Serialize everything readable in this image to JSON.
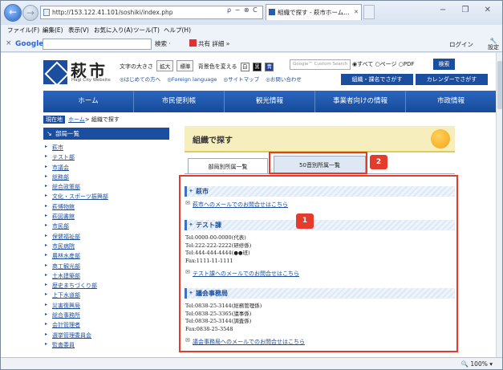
{
  "browser": {
    "url": "http://153.122.41.101/soshiki/index.php",
    "tab_title": "組織で探す - 萩市ホーム...",
    "url_tools": "ρ − ⊗ C",
    "window_controls": "− ❐ ✕"
  },
  "menu": [
    "ファイル(F)",
    "編集(E)",
    "表示(V)",
    "お気に入り(A)",
    "ツール(T)",
    "ヘルプ(H)"
  ],
  "toolbar": {
    "close": "×",
    "google": "Google",
    "search_btn": "検索 ·",
    "share": "共有",
    "detail": "詳細 »",
    "login": "ログイン",
    "settings": "設定"
  },
  "site": {
    "logo": "萩市",
    "logo_sub": "Hagi City Website",
    "font_size_label": "文字の大きさ",
    "enlarge": "拡大",
    "standard": "標準",
    "bg_label": "背景色を変える",
    "bg_w": "白",
    "bg_k": "黒",
    "bg_b": "青",
    "links": [
      "◎はじめての方へ",
      "◎Foreign language",
      "◎サイトマップ",
      "◎お問い合わせ"
    ],
    "search_placeholder": "Google™ Custom Search",
    "radios": "◉すべて ○ページ ○PDF",
    "search_btn": "検索",
    "org_btn": "組織・課名でさがす",
    "cal_btn": "カレンダーでさがす"
  },
  "gnav": [
    "ホーム",
    "市民便利帳",
    "観光情報",
    "事業者向けの情報",
    "市政情報"
  ],
  "breadcrumb": {
    "here": "現在地",
    "home": "ホーム",
    "current": "> 組織で探す"
  },
  "sidebar": {
    "title": "部局一覧",
    "items": [
      "萩市",
      "テスト部",
      "市議会",
      "総務部",
      "総合政策部",
      "文化・スポーツ振興部",
      "萩博物館",
      "萩図書館",
      "市民部",
      "保健福祉部",
      "市民病院",
      "農林水産部",
      "商工観光部",
      "土木建築部",
      "歴史まちづくり部",
      "上下水道部",
      "災害復興局",
      "総合事務所",
      "会計管理者",
      "選挙管理委員会",
      "監査委員"
    ]
  },
  "main": {
    "title": "組織で探す",
    "tab1": "部局別所属一覧",
    "tab2": "50音別所属一覧",
    "badge1": "1",
    "badge2": "2",
    "sections": [
      {
        "heading": "萩市",
        "mail": "萩市へのメールでのお問合せはこちら",
        "lines": []
      },
      {
        "heading": "テスト課",
        "mail": "テスト課へのメールでのお問合せはこちら",
        "lines": [
          "Tel:0000-00-0000(代表)",
          "Tel:222-222-2222(研修係)",
          "Tel:444-444-4444(●●班)",
          "Fax:1111-11-1111"
        ]
      },
      {
        "heading": "議会事務局",
        "mail": "議会事務局へのメールでのお問合せはこちら",
        "lines": [
          "Tel:0838-25-3144(総務管理係)",
          "Tel:0838-25-3365(議事係)",
          "Tel:0838-25-3144(調査係)",
          "Fax:0838-25-3548"
        ]
      }
    ]
  },
  "status": {
    "zoom": "🔍 100%  ▾"
  }
}
